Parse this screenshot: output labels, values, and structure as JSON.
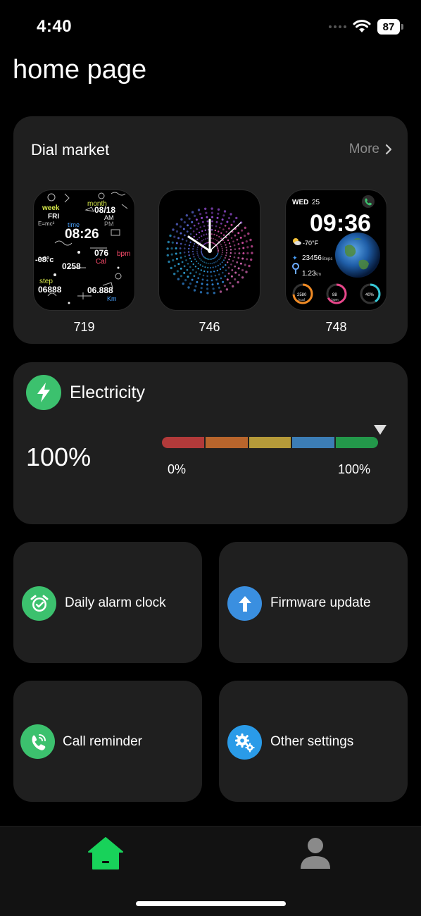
{
  "status_bar": {
    "time": "4:40",
    "battery": "87"
  },
  "page_title": "home page",
  "dial_market": {
    "title": "Dial market",
    "more_label": "More",
    "dials": [
      {
        "id": "719",
        "name": "doodle-dial"
      },
      {
        "id": "746",
        "name": "analog-particle-dial"
      },
      {
        "id": "748",
        "name": "earth-digital-dial",
        "day": "WED",
        "date": "25",
        "time": "09:36",
        "temperature": "-70°F",
        "steps": "23456",
        "steps_unit": "Steps",
        "distance": "1.23",
        "distance_unit": "Km",
        "kcal": "2580",
        "kcal_unit": "kcal",
        "heart": "88",
        "heart_unit": "bpm",
        "battery": "40%"
      }
    ],
    "doodle_texts": {
      "week": "week",
      "fri": "FRI",
      "month": "month",
      "date": "08/18",
      "am": "AM",
      "pm": "PM",
      "emc": "E=mc²",
      "time_label": "time",
      "time": "08:26",
      "temp": "-08°c",
      "bpm_value": "076",
      "bpm": "bpm",
      "cal_label": "Cal",
      "cal": "0258",
      "step_label": "step",
      "steps": "06888",
      "km": "06.888",
      "km_label": "Km"
    }
  },
  "electricity": {
    "title": "Electricity",
    "percent": "100%",
    "level": 1.0,
    "min_label": "0%",
    "max_label": "100%",
    "segment_colors": [
      "#b23a3a",
      "#b8652c",
      "#b59a39",
      "#3c7db5",
      "#23984a"
    ]
  },
  "tiles": [
    {
      "label": "Daily alarm clock",
      "icon": "alarm-clock-icon",
      "color": "#3cc16e"
    },
    {
      "label": "Firmware update",
      "icon": "upload-arrow-icon",
      "color": "#3a8fe0"
    },
    {
      "label": "Call reminder",
      "icon": "phone-call-icon",
      "color": "#3cc16e"
    },
    {
      "label": "Other settings",
      "icon": "gears-icon",
      "color": "#2a9be8"
    }
  ],
  "bottom_nav": {
    "items": [
      {
        "name": "home",
        "icon": "home-icon",
        "active": true,
        "color": "#18d25a"
      },
      {
        "name": "profile",
        "icon": "person-icon",
        "active": false,
        "color": "#8a8a8a"
      }
    ]
  }
}
